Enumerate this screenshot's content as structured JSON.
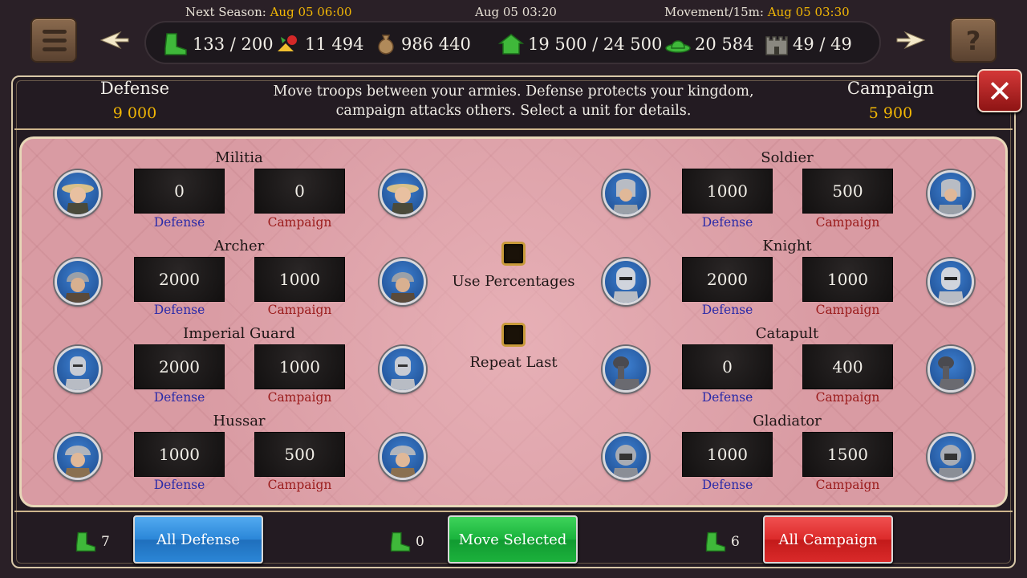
{
  "top": {
    "next_season_label": "Next Season:",
    "next_season_value": "Aug 05 06:00",
    "current_time": "Aug 05 03:20",
    "movement_label": "Movement/15m:",
    "movement_value": "Aug 05 03:30"
  },
  "resources": [
    {
      "icon": "boot-icon",
      "value": "133 / 200"
    },
    {
      "icon": "food-icon",
      "value": "11 494"
    },
    {
      "icon": "money-bag-icon",
      "value": "986 440"
    },
    {
      "icon": "house-icon",
      "value": "19 500 / 24 500"
    },
    {
      "icon": "hat-icon",
      "value": "20 584"
    },
    {
      "icon": "castle-icon",
      "value": "49 / 49"
    }
  ],
  "header": {
    "defense_label": "Defense",
    "defense_value": "9 000",
    "campaign_label": "Campaign",
    "campaign_value": "5 900",
    "description": "Move troops between your armies. Defense protects your kingdom, campaign attacks others. Select a unit for details."
  },
  "units_left": [
    {
      "name": "Militia",
      "defense": "0",
      "campaign": "0",
      "portrait": "militia-portrait"
    },
    {
      "name": "Archer",
      "defense": "2000",
      "campaign": "1000",
      "portrait": "archer-portrait"
    },
    {
      "name": "Imperial Guard",
      "defense": "2000",
      "campaign": "1000",
      "portrait": "imperial-guard-portrait"
    },
    {
      "name": "Hussar",
      "defense": "1000",
      "campaign": "500",
      "portrait": "hussar-portrait"
    }
  ],
  "units_right": [
    {
      "name": "Soldier",
      "defense": "1000",
      "campaign": "500",
      "portrait": "soldier-portrait"
    },
    {
      "name": "Knight",
      "defense": "2000",
      "campaign": "1000",
      "portrait": "knight-portrait"
    },
    {
      "name": "Catapult",
      "defense": "0",
      "campaign": "400",
      "portrait": "catapult-portrait"
    },
    {
      "name": "Gladiator",
      "defense": "1000",
      "campaign": "1500",
      "portrait": "gladiator-portrait"
    }
  ],
  "labels": {
    "defense": "Defense",
    "campaign": "Campaign"
  },
  "options": {
    "use_percentages": "Use Percentages",
    "repeat_last": "Repeat Last"
  },
  "bottom": {
    "left_count": "7",
    "center_count": "0",
    "right_count": "6",
    "all_defense": "All Defense",
    "move_selected": "Move Selected",
    "all_campaign": "All Campaign"
  },
  "colors": {
    "accent_yellow": "#f2b705",
    "defense_label": "#2a2aa8",
    "campaign_label": "#9a1a1a",
    "panel": "#d99ba3"
  }
}
